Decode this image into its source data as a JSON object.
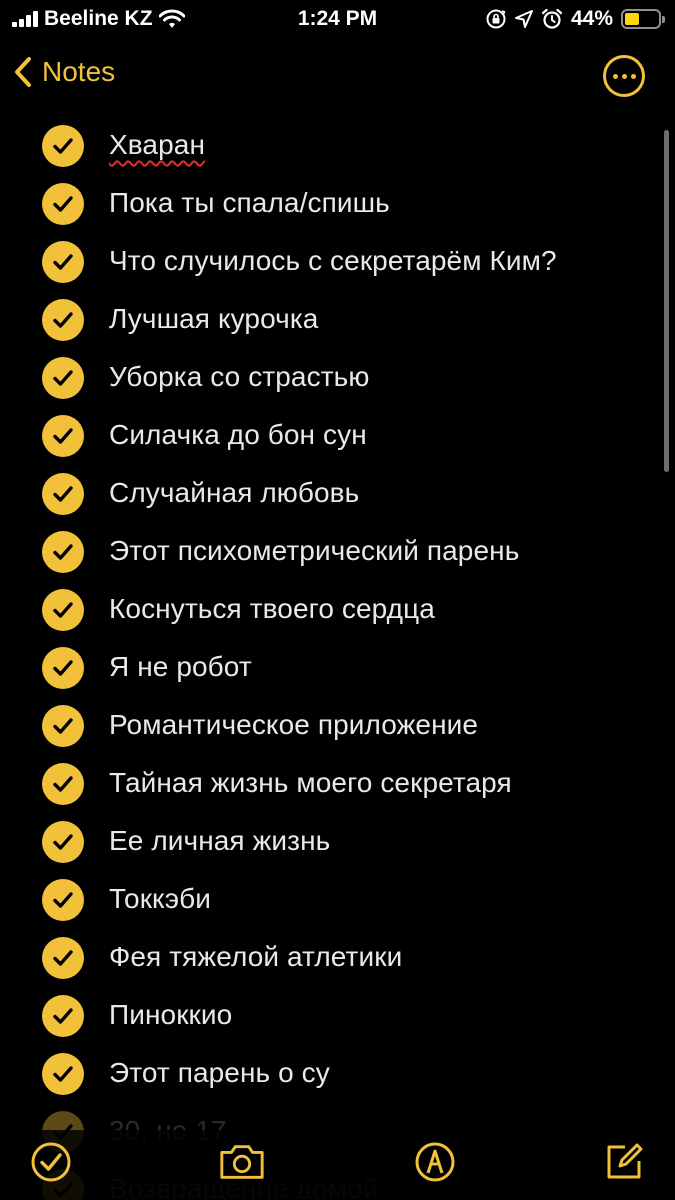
{
  "status_bar": {
    "carrier": "Beeline KZ",
    "time": "1:24 PM",
    "battery_percent": "44%",
    "battery_level": 0.44,
    "accent_color": "#ffd60a"
  },
  "nav": {
    "back_label": "Notes",
    "icons": {
      "back": "chevron-left-icon",
      "more": "ellipsis-circle-icon"
    }
  },
  "accent_color": "#f2c13a",
  "checklist": {
    "items": [
      {
        "label": "Хваран",
        "checked": true,
        "spellcheck_flag": true
      },
      {
        "label": "Пока ты спала/спишь",
        "checked": true
      },
      {
        "label": "Что случилось с секретарём Ким?",
        "checked": true
      },
      {
        "label": "Лучшая курочка",
        "checked": true
      },
      {
        "label": "Уборка со страстью",
        "checked": true
      },
      {
        "label": "Силачка до бон сун",
        "checked": true
      },
      {
        "label": "Случайная любовь",
        "checked": true
      },
      {
        "label": "Этот психометрический парень",
        "checked": true
      },
      {
        "label": "Коснуться твоего сердца",
        "checked": true
      },
      {
        "label": "Я не робот",
        "checked": true
      },
      {
        "label": "Романтическое приложение",
        "checked": true
      },
      {
        "label": "Тайная жизнь моего секретаря",
        "checked": true
      },
      {
        "label": "Ее личная жизнь",
        "checked": true
      },
      {
        "label": "Токкэби",
        "checked": true
      },
      {
        "label": "Фея тяжелой атлетики",
        "checked": true
      },
      {
        "label": "Пиноккио",
        "checked": true
      },
      {
        "label": "Этот парень о су",
        "checked": true
      },
      {
        "label": "30, но 17",
        "checked": true,
        "partially_hidden": true
      },
      {
        "label": "Возвращение домой",
        "checked": true,
        "partially_hidden": true
      }
    ]
  },
  "toolbar": {
    "icons": [
      "checklist-icon",
      "camera-icon",
      "markup-pen-icon",
      "compose-icon"
    ]
  }
}
